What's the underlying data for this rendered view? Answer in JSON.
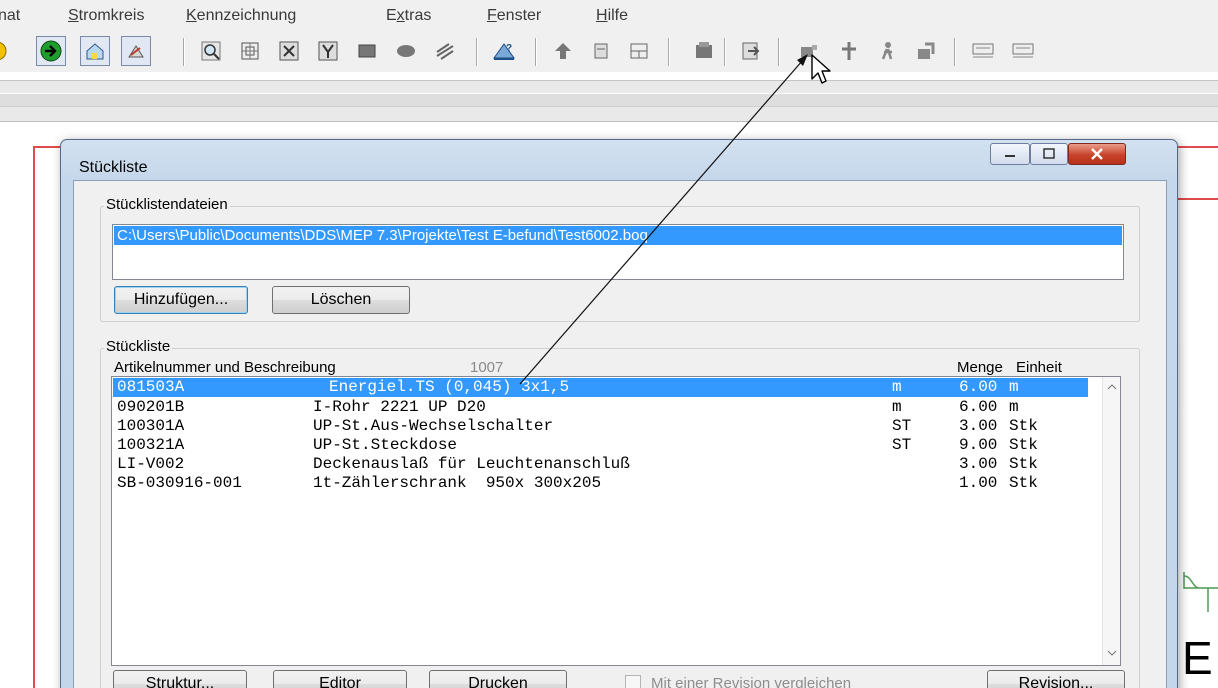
{
  "menu": {
    "items": [
      {
        "pre": "",
        "key": "",
        "rest": "nat"
      },
      {
        "pre": "",
        "key": "S",
        "rest": "tromkreis"
      },
      {
        "pre": "",
        "key": "K",
        "rest": "ennzeichnung"
      },
      {
        "pre": "E",
        "key": "x",
        "rest": "tras"
      },
      {
        "pre": "",
        "key": "F",
        "rest": "enster"
      },
      {
        "pre": "",
        "key": "H",
        "rest": "ilfe"
      }
    ]
  },
  "toolbar": {
    "icons": [
      "record-icon",
      "arrow-right-icon",
      "house-icon",
      "satellite-icon",
      "zoom-icon",
      "select-window-icon",
      "x-icon",
      "y-icon",
      "block-icon",
      "ellipse-icon",
      "hatch-icon",
      "edit-icon",
      "up-icon",
      "panel-icon",
      "window-icon",
      "parts-list-icon",
      "export-icon",
      "connector-icon",
      "move-icon",
      "person-icon",
      "forward-icon",
      "numbering-icon",
      "label-icon"
    ]
  },
  "dialog": {
    "title": "Stückliste",
    "files_group": {
      "label": "Stücklistendateien",
      "files": [
        "C:\\Users\\Public\\Documents\\DDS\\MEP 7.3\\Projekte\\Test E-befund\\Test6002.boq"
      ],
      "add_button": "Hinzufügen...",
      "delete_button": "Löschen"
    },
    "list_group": {
      "label": "Stückliste",
      "header_article": "Artikelnummer und  Beschreibung",
      "header_count": "1007",
      "header_qty": "Menge",
      "header_unit": "Einheit",
      "rows": [
        {
          "article": "081503A",
          "desc": "Energiel.TS (0,045) 3x1,5",
          "type": "m",
          "qty": "6.00",
          "unit": "m",
          "selected": true
        },
        {
          "article": "090201B",
          "desc": "I-Rohr 2221 UP D20",
          "type": "m",
          "qty": "6.00",
          "unit": "m",
          "selected": false
        },
        {
          "article": "100301A",
          "desc": "UP-St.Aus-Wechselschalter",
          "type": "ST",
          "qty": "3.00",
          "unit": "Stk",
          "selected": false
        },
        {
          "article": "100321A",
          "desc": "UP-St.Steckdose",
          "type": "ST",
          "qty": "9.00",
          "unit": "Stk",
          "selected": false
        },
        {
          "article": "LI-V002",
          "desc": "Deckenauslaß für Leuchtenanschluß",
          "type": "",
          "qty": "3.00",
          "unit": "Stk",
          "selected": false
        },
        {
          "article": "SB-030916-001",
          "desc": "1t-Zählerschrank  950x 300x205",
          "type": "",
          "qty": "1.00",
          "unit": "Stk",
          "selected": false
        }
      ]
    },
    "buttons": {
      "structure": "Struktur...",
      "editor": "Editor",
      "print": "Drucken",
      "compare_label": "Mit einer Revision vergleichen",
      "revision": "Revision..."
    }
  },
  "canvas_edge_text": "E",
  "colors": {
    "selection": "#3399ff",
    "dialog_frame": "#c5d7eb",
    "close_button": "#c8432b",
    "drawing_border": "#e04b4b"
  }
}
